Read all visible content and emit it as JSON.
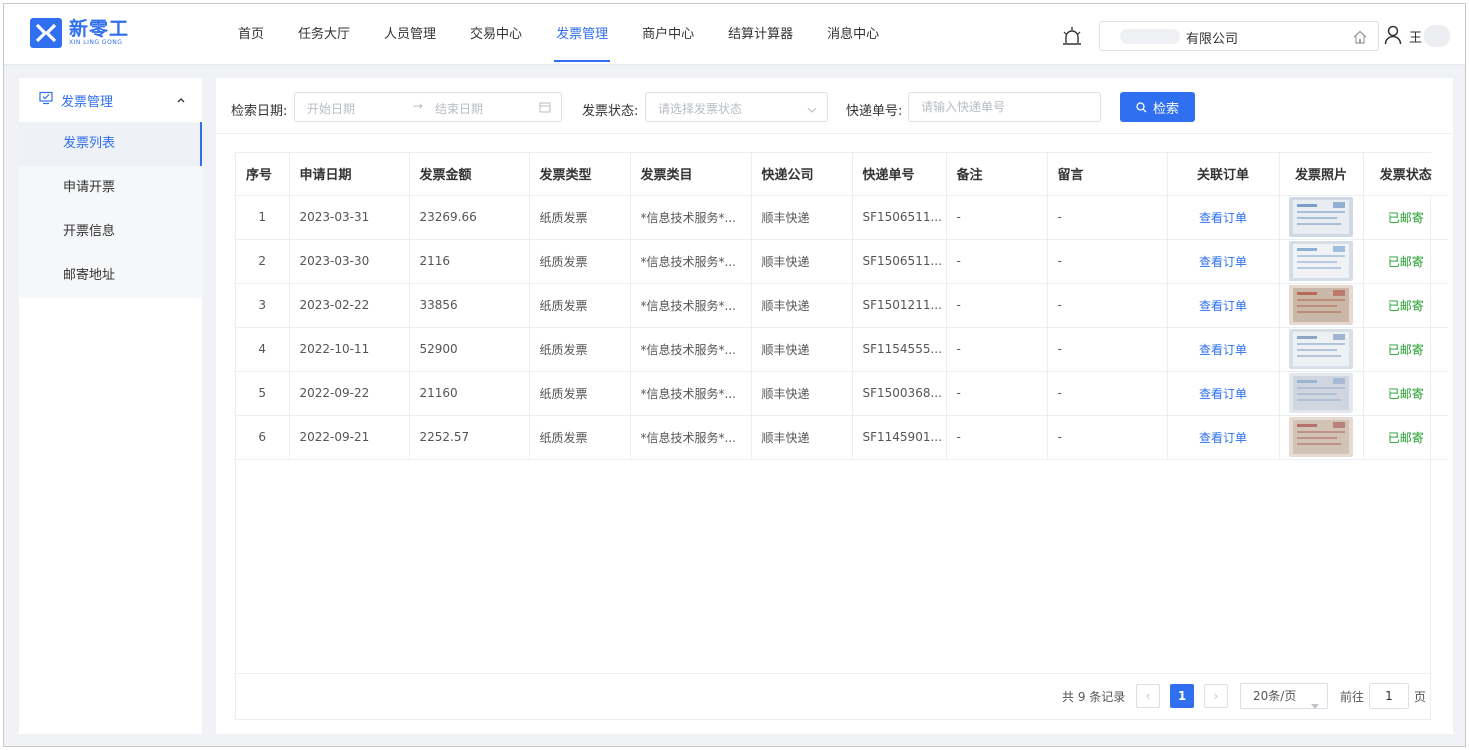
{
  "header": {
    "logo_name": "新零工",
    "logo_sub": "XIN LING GONG",
    "nav": [
      "首页",
      "任务大厅",
      "人员管理",
      "交易中心",
      "发票管理",
      "商户中心",
      "结算计算器",
      "消息中心"
    ],
    "active_nav": 4,
    "company_suffix": "有限公司",
    "user_name": "王"
  },
  "sidebar": {
    "group_label": "发票管理",
    "items": [
      {
        "label": "发票列表",
        "active": true
      },
      {
        "label": "申请开票",
        "active": false
      },
      {
        "label": "开票信息",
        "active": false
      },
      {
        "label": "邮寄地址",
        "active": false
      }
    ]
  },
  "filters": {
    "date_label": "检索日期:",
    "start_placeholder": "开始日期",
    "range_arrow": "→",
    "end_placeholder": "结束日期",
    "status_label": "发票状态:",
    "status_placeholder": "请选择发票状态",
    "express_label": "快递单号:",
    "express_placeholder": "请输入快递单号",
    "search_button": "检索"
  },
  "table": {
    "columns": [
      "序号",
      "申请日期",
      "发票金额",
      "发票类型",
      "发票类目",
      "快递公司",
      "快递单号",
      "备注",
      "留言",
      "关联订单",
      "发票照片",
      "发票状态"
    ],
    "rows": [
      {
        "no": "1",
        "date": "2023-03-31",
        "amount": "23269.66",
        "type": "纸质发票",
        "category": "*信息技术服务*...",
        "courier": "顺丰快递",
        "tracking": "SF1506511...",
        "remark": "-",
        "message": "-",
        "order": "查看订单",
        "photo": "invoice-photo",
        "status": "已邮寄"
      },
      {
        "no": "2",
        "date": "2023-03-30",
        "amount": "2116",
        "type": "纸质发票",
        "category": "*信息技术服务*...",
        "courier": "顺丰快递",
        "tracking": "SF1506511...",
        "remark": "-",
        "message": "-",
        "order": "查看订单",
        "photo": "invoice-photo",
        "status": "已邮寄"
      },
      {
        "no": "3",
        "date": "2023-02-22",
        "amount": "33856",
        "type": "纸质发票",
        "category": "*信息技术服务*...",
        "courier": "顺丰快递",
        "tracking": "SF1501211...",
        "remark": "-",
        "message": "-",
        "order": "查看订单",
        "photo": "invoice-photo",
        "status": "已邮寄"
      },
      {
        "no": "4",
        "date": "2022-10-11",
        "amount": "52900",
        "type": "纸质发票",
        "category": "*信息技术服务*...",
        "courier": "顺丰快递",
        "tracking": "SF1154555...",
        "remark": "-",
        "message": "-",
        "order": "查看订单",
        "photo": "invoice-photo",
        "status": "已邮寄"
      },
      {
        "no": "5",
        "date": "2022-09-22",
        "amount": "21160",
        "type": "纸质发票",
        "category": "*信息技术服务*...",
        "courier": "顺丰快递",
        "tracking": "SF1500368...",
        "remark": "-",
        "message": "-",
        "order": "查看订单",
        "photo": "invoice-photo",
        "status": "已邮寄"
      },
      {
        "no": "6",
        "date": "2022-09-21",
        "amount": "2252.57",
        "type": "纸质发票",
        "category": "*信息技术服务*...",
        "courier": "顺丰快递",
        "tracking": "SF1145901...",
        "remark": "-",
        "message": "-",
        "order": "查看订单",
        "photo": "invoice-photo",
        "status": "已邮寄"
      }
    ]
  },
  "pagination": {
    "total_text": "共 9 条记录",
    "prev": "‹",
    "current": "1",
    "next": "›",
    "page_size": "20条/页",
    "goto_label": "前往",
    "goto_value": "1",
    "page_unit": "页"
  },
  "colors": {
    "primary": "#2f6ff0",
    "status_ok": "#1f9d2a"
  },
  "icons": [
    "bell-icon",
    "home-icon",
    "user-icon",
    "invoice-icon",
    "chevron-up-icon",
    "calendar-icon",
    "chevron-down-icon",
    "search-icon"
  ]
}
